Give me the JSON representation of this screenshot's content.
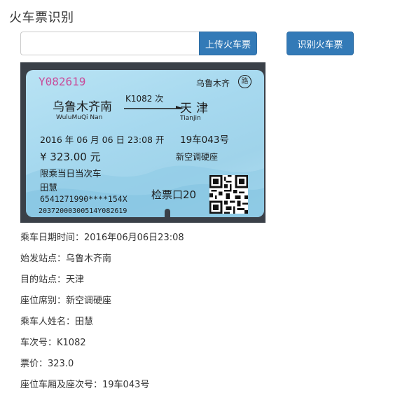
{
  "page": {
    "title": "火车票识别"
  },
  "upload": {
    "file_input_value": "",
    "upload_button_label": "上传火车票",
    "recognize_button_label": "识别火车票"
  },
  "ticket": {
    "serial": "Y082619",
    "issuer": "乌鲁木齐",
    "issuer_logo": "路",
    "from_station": "乌鲁木齐南",
    "from_pinyin": "WuluMuQi Nan",
    "train_no": "K1082 次",
    "to_station": "天津",
    "to_pinyin": "Tianjin",
    "datetime": "2016 年 06 月 06 日 23:08 开",
    "seat": "19车043号",
    "price": "¥ 323.00 元",
    "seat_class": "新空调硬座",
    "note": "限乘当日当次车",
    "passenger": "田慧",
    "id_number": "6541271990****154X",
    "gate": "检票口20",
    "code": "20372000300514Y082619"
  },
  "results": [
    {
      "label": "乘车日期时间：",
      "value": "2016年06月06日23:08"
    },
    {
      "label": "始发站点：",
      "value": "乌鲁木齐南"
    },
    {
      "label": "目的站点：",
      "value": "天津"
    },
    {
      "label": "座位席别：",
      "value": "新空调硬座"
    },
    {
      "label": "乘车人姓名：",
      "value": "田慧"
    },
    {
      "label": "车次号：",
      "value": "K1082"
    },
    {
      "label": "票价：",
      "value": "323.0"
    },
    {
      "label": "座位车厢及座次号：",
      "value": "19车043号"
    }
  ]
}
